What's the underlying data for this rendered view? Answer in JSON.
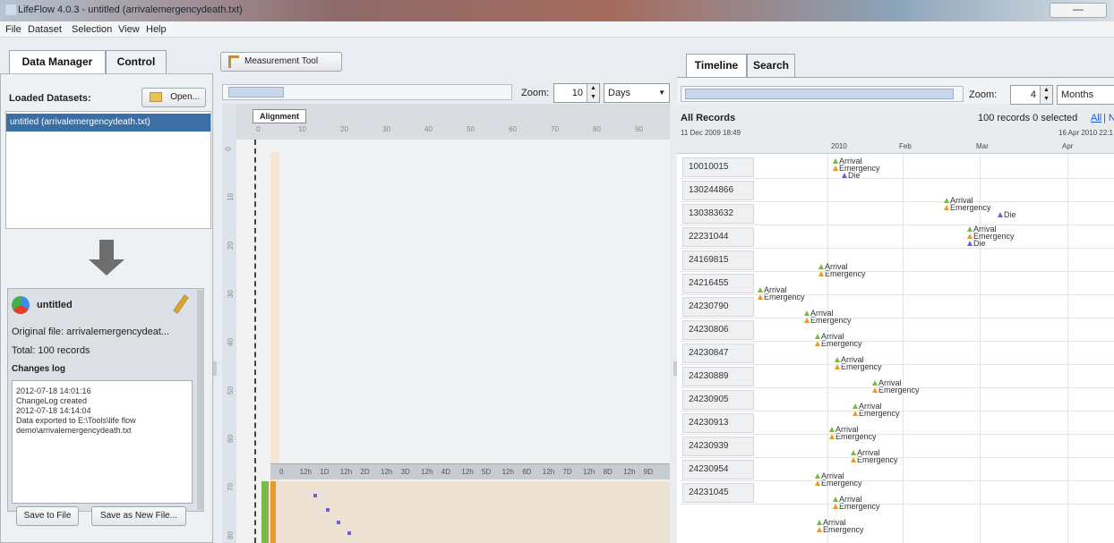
{
  "window": {
    "title": "LifeFlow 4.0.3 - untitled (arrivalemergencydeath.txt)",
    "controls": "—"
  },
  "menu": [
    "File",
    "Dataset",
    "Selection",
    "View",
    "Help"
  ],
  "left": {
    "tabs": [
      "Data Manager",
      "Control"
    ],
    "loaded_label": "Loaded Datasets:",
    "open_button": "Open...",
    "dataset_item": "untitled (arrivalemergencydeath.txt)",
    "card": {
      "name": "untitled",
      "original_file": "Original file: arrivalemergencydeat...",
      "total": "Total: 100 records",
      "changes_label": "Changes log",
      "log": [
        "2012-07-18 14:01:16",
        "ChangeLog created",
        "2012-07-18 14:14:04",
        " Data exported to E:\\Tools\\life flow",
        "demo\\arrivalemergencydeath.txt"
      ]
    },
    "save_button": "Save to File",
    "save_new_button": "Save as New File..."
  },
  "middle": {
    "tool_button": "Measurement Tool",
    "zoom_label": "Zoom:",
    "zoom_value": "10",
    "zoom_unit": "Days",
    "alignment_label": "Alignment",
    "top_ticks": [
      "0",
      "10",
      "20",
      "30",
      "40",
      "50",
      "60",
      "70",
      "80",
      "90"
    ],
    "left_ticks": [
      "0",
      "10",
      "20",
      "30",
      "40",
      "50",
      "60",
      "70",
      "80"
    ],
    "hour_ticks": [
      "0",
      "12h",
      "1D",
      "12h",
      "2D",
      "12h",
      "3D",
      "12h",
      "4D",
      "12h",
      "5D",
      "12h",
      "6D",
      "12h",
      "7D",
      "12h",
      "8D",
      "12h",
      "9D"
    ]
  },
  "right": {
    "tabs": [
      "Timeline",
      "Search"
    ],
    "zoom_label": "Zoom:",
    "zoom_value": "4",
    "zoom_unit": "Months",
    "all_records": "All Records",
    "records_info": "100 records 0 selected",
    "all_link": "All",
    "none_link": "| N",
    "start_time": "11 Dec 2009 18:49",
    "end_time": "16 Apr 2010 22:1",
    "months": [
      "2010",
      "Feb",
      "Mar",
      "Apr"
    ],
    "rows": [
      {
        "id": "10010015",
        "events": [
          "Arrival",
          "Emergency",
          "Die"
        ]
      },
      {
        "id": "130244866",
        "events": [
          "Arrival",
          "Emergency",
          "Die"
        ]
      },
      {
        "id": "130383632",
        "events": [
          "Arrival",
          "Emergency",
          "Die"
        ]
      },
      {
        "id": "22231044",
        "events": [
          "Arrival",
          "Emergency"
        ]
      },
      {
        "id": "24169815",
        "events": [
          "Arrival",
          "Emergency"
        ]
      },
      {
        "id": "24216455",
        "events": [
          "Arrival",
          "Emergency"
        ]
      },
      {
        "id": "24230790",
        "events": [
          "Arrival",
          "Emergency"
        ]
      },
      {
        "id": "24230806",
        "events": [
          "Arrival",
          "Emergency"
        ]
      },
      {
        "id": "24230847",
        "events": [
          "Arrival",
          "Emergency"
        ]
      },
      {
        "id": "24230889",
        "events": [
          "Arrival",
          "Emergency"
        ]
      },
      {
        "id": "24230905",
        "events": [
          "Arrival",
          "Emergency"
        ]
      },
      {
        "id": "24230913",
        "events": [
          "Arrival",
          "Emergency"
        ]
      },
      {
        "id": "24230939",
        "events": [
          "Arrival",
          "Emergency"
        ]
      },
      {
        "id": "24230954",
        "events": [
          "Arrival",
          "Emergency"
        ]
      },
      {
        "id": "24231045",
        "events": [
          "Arrival",
          "Emergency"
        ]
      }
    ]
  },
  "colors": {
    "arrival": "#7ab94a",
    "emergency": "#e89a2a",
    "die": "#6b62d8",
    "selection": "#3a6ea5"
  }
}
